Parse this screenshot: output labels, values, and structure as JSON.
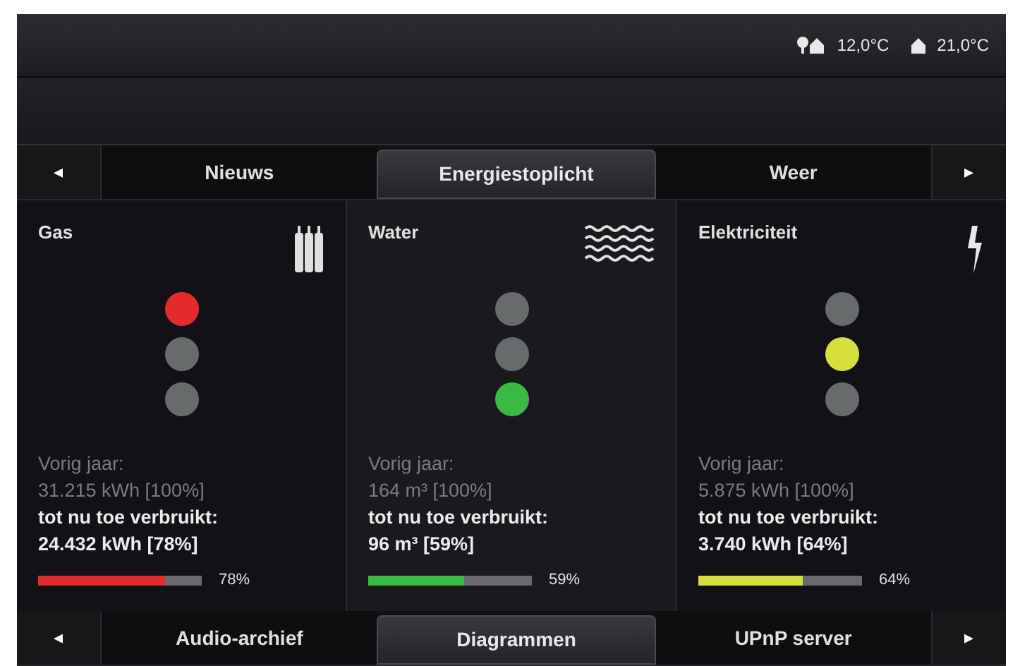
{
  "status_bar": {
    "outdoor_temp": "12,0°C",
    "indoor_temp": "21,0°C"
  },
  "top_tabs": {
    "prev": "◂",
    "next": "▸",
    "tabs": [
      {
        "label": "Nieuws",
        "selected": false
      },
      {
        "label": "Energiestoplicht",
        "selected": true
      },
      {
        "label": "Weer",
        "selected": false
      }
    ]
  },
  "panels": [
    {
      "kind": "gas",
      "title": "Gas",
      "color": "#e42a2a",
      "lights": [
        {
          "on": true
        },
        {
          "on": false
        },
        {
          "on": false
        }
      ],
      "last_year_label": "Vorig jaar:",
      "last_year_value": "31.215 kWh [100%]",
      "used_label": "tot nu toe verbruikt:",
      "used_value": "24.432 kWh [78%]",
      "level": 0.78,
      "percent": "78%"
    },
    {
      "kind": "water",
      "title": "Water",
      "color": "#3cb944",
      "lights": [
        {
          "on": false
        },
        {
          "on": false
        },
        {
          "on": true
        }
      ],
      "last_year_label": "Vorig jaar:",
      "last_year_value": "164 m³ [100%]",
      "used_label": "tot nu toe verbruikt:",
      "used_value": "96 m³ [59%]",
      "level": 0.59,
      "percent": "59%"
    },
    {
      "kind": "electricity",
      "title": "Elektriciteit",
      "color": "#d7e03a",
      "lights": [
        {
          "on": false
        },
        {
          "on": true
        },
        {
          "on": false
        }
      ],
      "last_year_label": "Vorig jaar:",
      "last_year_value": "5.875 kWh [100%]",
      "used_label": "tot nu toe verbruikt:",
      "used_value": "3.740 kWh [64%]",
      "level": 0.64,
      "percent": "64%"
    }
  ],
  "bottom_tabs": {
    "prev": "◂",
    "next": "▸",
    "tabs": [
      {
        "label": "Audio-archief",
        "selected": false
      },
      {
        "label": "Diagrammen",
        "selected": true
      },
      {
        "label": "UPnP server",
        "selected": false
      }
    ]
  }
}
